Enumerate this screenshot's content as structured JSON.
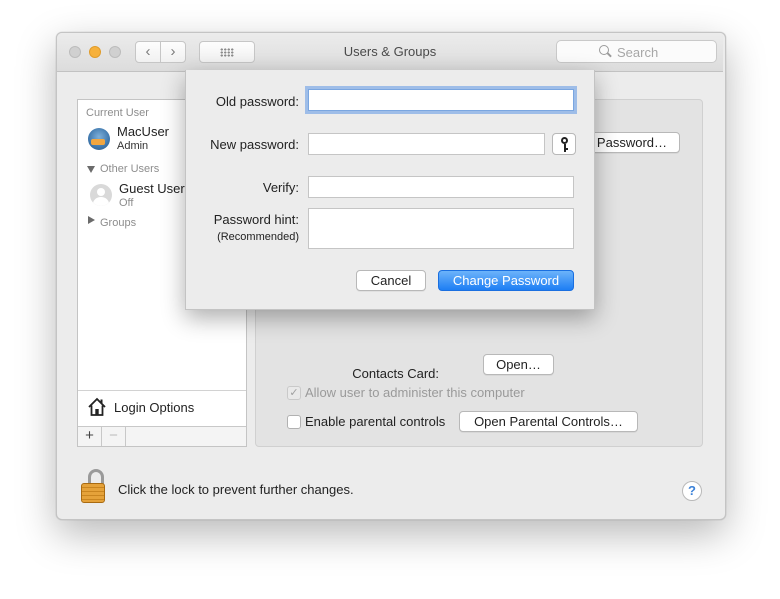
{
  "window": {
    "title": "Users & Groups",
    "search_placeholder": "Search"
  },
  "sidebar": {
    "current_user_header": "Current User",
    "current_user": {
      "name": "MacUser",
      "role": "Admin"
    },
    "other_users_header": "Other Users",
    "guest_user": {
      "name": "Guest User",
      "status": "Off"
    },
    "groups_label": "Groups",
    "login_options_label": "Login Options",
    "add_label": "+",
    "remove_label": "−"
  },
  "main": {
    "change_password_partial": "Password…",
    "contacts_card_label": "Contacts Card:",
    "open_button": "Open…",
    "allow_admin_label": "Allow user to administer this computer",
    "allow_admin_checked": true,
    "parental_controls_label": "Enable parental controls",
    "parental_controls_checked": false,
    "open_parental_controls_button": "Open Parental Controls…"
  },
  "footer": {
    "lock_text": "Click the lock to prevent further changes.",
    "help_label": "?"
  },
  "sheet": {
    "old_password_label": "Old password:",
    "old_password_value": "",
    "new_password_label": "New password:",
    "new_password_value": "",
    "verify_label": "Verify:",
    "verify_value": "",
    "hint_label": "Password hint:",
    "hint_sublabel": "(Recommended)",
    "hint_value": "",
    "cancel_button": "Cancel",
    "change_password_button": "Change Password"
  },
  "colors": {
    "accent": "#1e7ef4",
    "minimize_light": "#f6b13c",
    "focus_ring": "#5f98e6"
  }
}
